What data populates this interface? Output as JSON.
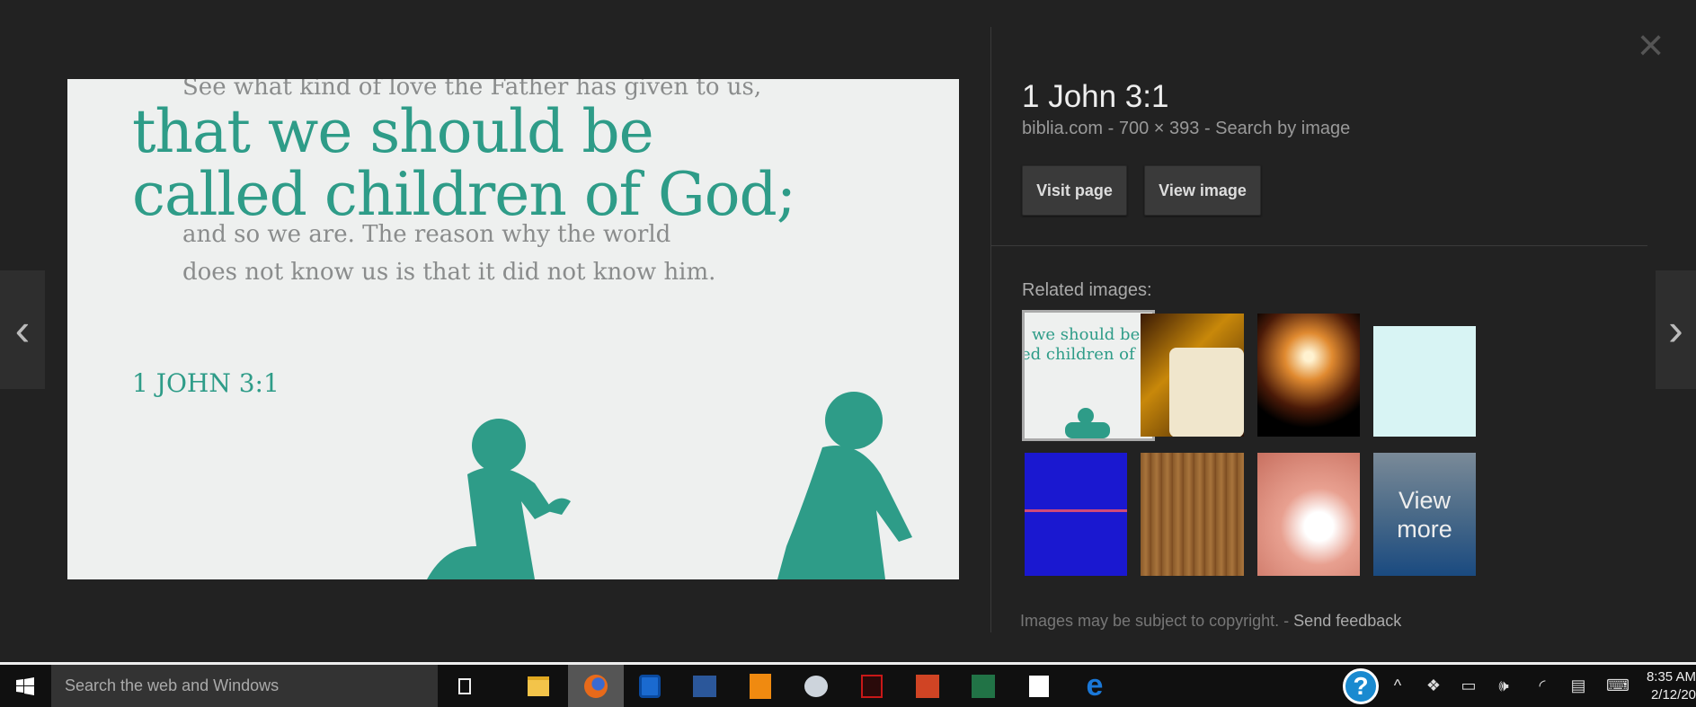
{
  "image": {
    "line1": "See what kind of love the Father has given to us,",
    "big1": "that we should be",
    "big2": "called children of God;",
    "line2": "and so we are. The reason why the world",
    "line3": "does not know us is that it did not know him.",
    "ref": "1 JOHN 3:1",
    "accent": "#2e9c88"
  },
  "nav": {
    "prev": "‹",
    "next": "›",
    "close": "×"
  },
  "panel": {
    "title": "1 John 3:1",
    "source": "biblia.com",
    "sep": "-",
    "dims": "700 × 393",
    "search_by_image": "Search by image",
    "visit_page": "Visit page",
    "view_image": "View image",
    "related_label": "Related images:",
    "view_more": "View more",
    "copyright": "Images may be subject to copyright.",
    "send_feedback": "Send feedback"
  },
  "taskbar": {
    "search_placeholder": "Search the web and Windows",
    "time": "8:35 AM",
    "date": "2/12/20"
  }
}
